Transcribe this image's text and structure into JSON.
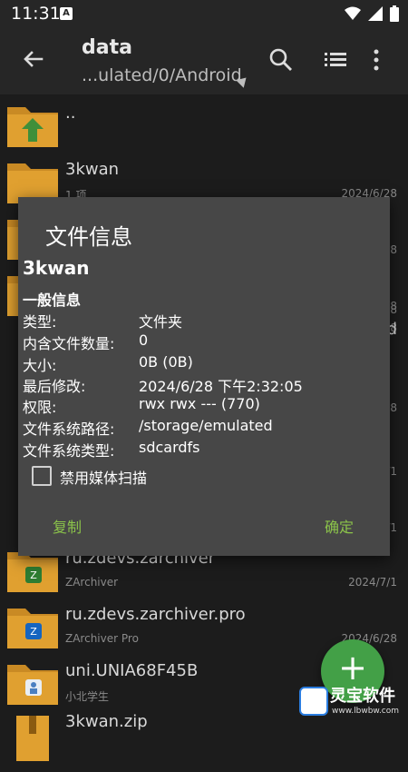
{
  "status_bar": {
    "time": "11:31",
    "notification_letter": "A"
  },
  "toolbar": {
    "title": "data",
    "path": "...ulated/0/Android"
  },
  "file_list": [
    {
      "name": "..",
      "sub": "",
      "date": ""
    },
    {
      "name": "3kwan",
      "sub": "1 项",
      "date": "2024/6/28"
    },
    {
      "name": "",
      "sub": "",
      "date": "28"
    },
    {
      "name": "",
      "sub": "",
      "date": "28"
    },
    {
      "name": "",
      "sub": "",
      "date": "28"
    },
    {
      "name": "",
      "sub": "",
      "date": "28"
    },
    {
      "name": "d",
      "sub": "",
      "date": ""
    },
    {
      "name": "",
      "sub": "",
      "date": "28"
    },
    {
      "name": "",
      "sub": "",
      "date": "/1"
    },
    {
      "name": "",
      "sub": "",
      "date": "/1"
    },
    {
      "name": "ru.zdevs.zarchiver",
      "sub": "ZArchiver",
      "date": "2024/7/1"
    },
    {
      "name": "ru.zdevs.zarchiver.pro",
      "sub": "ZArchiver Pro",
      "date": "2024/6/28"
    },
    {
      "name": "uni.UNIA68F45B",
      "sub": "小北学生",
      "date": ""
    },
    {
      "name": "3kwan.zip",
      "sub": "",
      "date": ""
    }
  ],
  "dialog": {
    "title": "文件信息",
    "name": "3kwan",
    "section": "一般信息",
    "fields": [
      {
        "key": "类型:",
        "value": "文件夹"
      },
      {
        "key": "内含文件数量:",
        "value": "0"
      },
      {
        "key": "大小:",
        "value": "0B (0B)"
      },
      {
        "key": "最后修改:",
        "value": "2024/6/28 下午2:32:05"
      },
      {
        "key": "权限:",
        "value": "rwx rwx --- (770)"
      },
      {
        "key": "文件系统路径:",
        "value": "/storage/emulated"
      },
      {
        "key": "文件系统类型:",
        "value": "sdcardfs"
      }
    ],
    "checkbox_label": "禁用媒体扫描",
    "checkbox_checked": false,
    "copy_label": "复制",
    "ok_label": "确定"
  },
  "fab": {
    "label": "+"
  },
  "watermark": {
    "text": "灵宝软件",
    "url": "www.lbwbw.com"
  },
  "colors": {
    "accent": "#8bc34a",
    "fab": "#43a047",
    "folder": "#e0a030",
    "dialog_bg": "#474747"
  }
}
